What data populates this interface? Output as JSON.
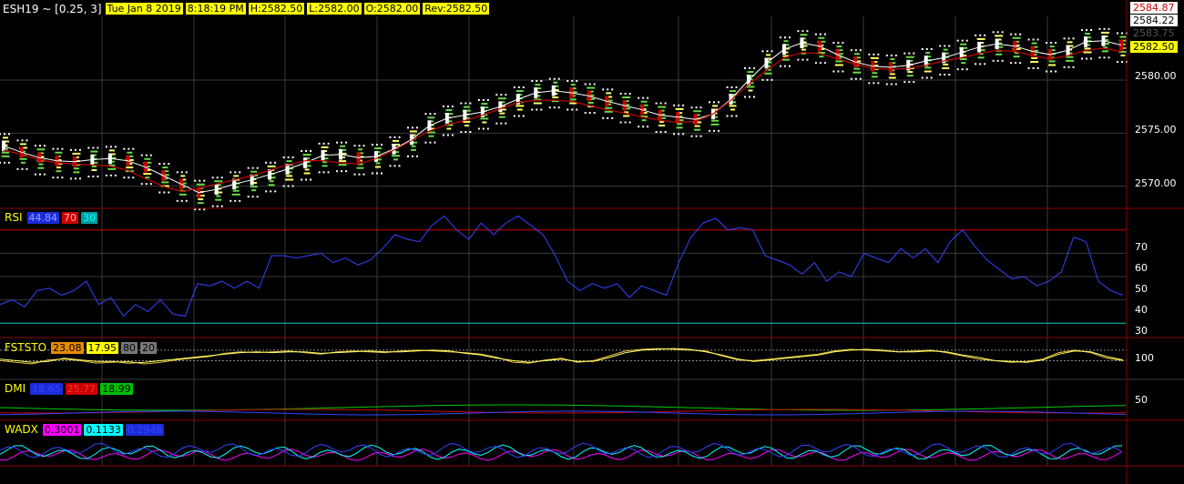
{
  "header": {
    "symbol": "ESH19 ~ [0.25, 3]",
    "date": "Tue Jan 8 2019",
    "time": "8:18:19 PM",
    "high": "H:2582.50",
    "low": "L:2582.00",
    "open": "O:2582.00",
    "rev": "Rev:2582.50"
  },
  "price_axis": {
    "ticks": [
      "2580.00",
      "2575.00",
      "2570.00"
    ],
    "tick_values": [
      2580,
      2575,
      2570
    ],
    "top_labels": [
      {
        "text": "2584.87",
        "bg": "#ffffff",
        "fg": "#cc0000"
      },
      {
        "text": "2584.22",
        "bg": "#ffffff",
        "fg": "#000000"
      },
      {
        "text": "2583.75",
        "bg": "#000000",
        "fg": "#555555"
      },
      {
        "text": "2582.50",
        "bg": "#ffff00",
        "fg": "#000000"
      }
    ]
  },
  "panels": {
    "rsi": {
      "name": "RSI",
      "values": [
        {
          "text": "44.84",
          "bg": "#1c2bd6",
          "fg": "#8ea0ff"
        },
        {
          "text": "70",
          "bg": "#cc0000",
          "fg": "#ffb0b0"
        },
        {
          "text": "30",
          "bg": "#00a0a0",
          "fg": "#00ffff"
        }
      ],
      "ticks": [
        "70",
        "60",
        "50",
        "40",
        "30"
      ]
    },
    "fststo": {
      "name": "FSTSTO",
      "values": [
        {
          "text": "23.08",
          "bg": "#e88a00",
          "fg": "#000000"
        },
        {
          "text": "17.95",
          "bg": "#ffff00",
          "fg": "#000000"
        },
        {
          "text": "80",
          "bg": "#777777",
          "fg": "#000000"
        },
        {
          "text": "20",
          "bg": "#777777",
          "fg": "#000000"
        }
      ],
      "ticks": [
        "100"
      ]
    },
    "dmi": {
      "name": "DMI",
      "values": [
        {
          "text": "18.65",
          "bg": "#1c2bd6",
          "fg": "#3344ff"
        },
        {
          "text": "25.77",
          "bg": "#cc0000",
          "fg": "#ff3333"
        },
        {
          "text": "18.99",
          "bg": "#00c000",
          "fg": "#000000"
        }
      ],
      "ticks": [
        "50"
      ]
    },
    "wadx": {
      "name": "WADX",
      "values": [
        {
          "text": "0.3001",
          "bg": "#ff00ff",
          "fg": "#000000"
        },
        {
          "text": "0.1133",
          "bg": "#00ffff",
          "fg": "#000000"
        },
        {
          "text": "0.2946",
          "bg": "#1c2bd6",
          "fg": "#3344ff"
        }
      ]
    }
  },
  "colors": {
    "background": "#000000",
    "grid": "#3a3a3a",
    "separator": "#8b0000",
    "up_candle": "#ffffff",
    "down_candle": "#cc0000",
    "ema_fast": "#ffffff",
    "ema_slow": "#cc0000",
    "rsi_line": "#3344ff",
    "sto_line": "#e8c040"
  },
  "chart_data": [
    {
      "type": "line",
      "panel": "price",
      "ylim": [
        2568,
        2586
      ],
      "series": [
        {
          "values": [
            2573.8,
            2573.2,
            2572.7,
            2572.4,
            2572.3,
            2572.5,
            2572.6,
            2572.4,
            2571.8,
            2571.0,
            2570.2,
            2569.4,
            2569.7,
            2570.2,
            2570.6,
            2571.1,
            2571.6,
            2572.2,
            2572.9,
            2573.0,
            2572.7,
            2572.8,
            2573.5,
            2574.4,
            2575.7,
            2576.4,
            2576.7,
            2577.0,
            2577.5,
            2578.2,
            2578.8,
            2579.0,
            2578.8,
            2578.5,
            2578.0,
            2577.6,
            2577.2,
            2576.7,
            2576.5,
            2576.3,
            2576.8,
            2578.2,
            2580.0,
            2581.6,
            2582.9,
            2583.5,
            2583.2,
            2582.4,
            2581.7,
            2581.3,
            2581.2,
            2581.4,
            2581.8,
            2582.1,
            2582.6,
            2583.1,
            2583.4,
            2583.2,
            2582.7,
            2582.4,
            2582.8,
            2583.6,
            2583.7,
            2583.3
          ]
        },
        {
          "values": [
            2573.4,
            2573.0,
            2572.5,
            2572.2,
            2572.1,
            2572.0,
            2571.9,
            2571.5,
            2570.7,
            2570.0,
            2569.5,
            2569.8,
            2570.2,
            2570.6,
            2571.0,
            2571.5,
            2572.0,
            2572.4,
            2572.4,
            2572.2,
            2572.1,
            2572.6,
            2573.4,
            2574.3,
            2575.2,
            2575.8,
            2576.2,
            2576.7,
            2577.3,
            2577.9,
            2578.1,
            2578.1,
            2578.0,
            2577.6,
            2577.2,
            2576.9,
            2576.5,
            2576.2,
            2576.0,
            2576.1,
            2576.8,
            2578.1,
            2579.6,
            2580.9,
            2582.1,
            2582.6,
            2582.5,
            2582.0,
            2581.5,
            2581.1,
            2581.0,
            2581.1,
            2581.4,
            2581.8,
            2582.1,
            2582.5,
            2582.8,
            2582.7,
            2582.3,
            2582.0,
            2582.3,
            2582.8,
            2583.0,
            2582.7
          ]
        }
      ]
    },
    {
      "type": "line",
      "panel": "rsi",
      "ylim": [
        25,
        75
      ],
      "series": [
        {
          "values": [
            38,
            40,
            37,
            44,
            45,
            42,
            44,
            48,
            38,
            41,
            33,
            38,
            35,
            40,
            34,
            33,
            47,
            46,
            48,
            45,
            48,
            45,
            59,
            59,
            58,
            59,
            60,
            56,
            58,
            55,
            57,
            62,
            68,
            66,
            65,
            72,
            76,
            70,
            66,
            73,
            68,
            73,
            76,
            72,
            68,
            59,
            48,
            44,
            47,
            45,
            47,
            41,
            46,
            44,
            42,
            56,
            67,
            73,
            75,
            70,
            71,
            70,
            59,
            57,
            55,
            51,
            56,
            48,
            52,
            50,
            60,
            58,
            56,
            62,
            58,
            62,
            56,
            65,
            70,
            63,
            57,
            53,
            49,
            50,
            46,
            48,
            52,
            67,
            65,
            48,
            44,
            42
          ]
        }
      ]
    },
    {
      "type": "line",
      "panel": "fststo",
      "ylim": [
        60,
        105
      ],
      "series": [
        {
          "values": [
            82,
            80,
            78,
            83,
            84,
            82,
            79,
            80,
            81,
            78,
            80,
            83,
            85,
            87,
            91,
            93,
            92,
            93,
            94,
            92,
            90,
            93,
            94,
            93,
            92,
            94,
            95,
            94,
            93,
            92,
            90,
            86,
            80,
            79,
            83,
            85,
            80,
            82,
            88,
            94,
            96,
            97,
            96,
            95,
            94,
            88,
            83,
            82,
            84,
            86,
            88,
            90,
            94,
            96,
            95,
            94,
            93,
            94,
            95,
            92,
            88,
            84,
            82,
            80,
            81,
            84,
            92,
            95,
            92,
            85,
            82
          ]
        },
        {
          "values": [
            84,
            82,
            80,
            81,
            85,
            83,
            81,
            81,
            79,
            80,
            82,
            84,
            86,
            88,
            90,
            92,
            93,
            92,
            93,
            93,
            91,
            92,
            93,
            94,
            93,
            93,
            94,
            95,
            94,
            91,
            89,
            85,
            82,
            80,
            82,
            84,
            81,
            81,
            86,
            92,
            95,
            96,
            97,
            96,
            93,
            89,
            84,
            81,
            83,
            85,
            87,
            89,
            93,
            95,
            96,
            95,
            93,
            93,
            94,
            93,
            89,
            86,
            82,
            81,
            80,
            83,
            90,
            94,
            93,
            87,
            83
          ]
        }
      ]
    }
  ]
}
